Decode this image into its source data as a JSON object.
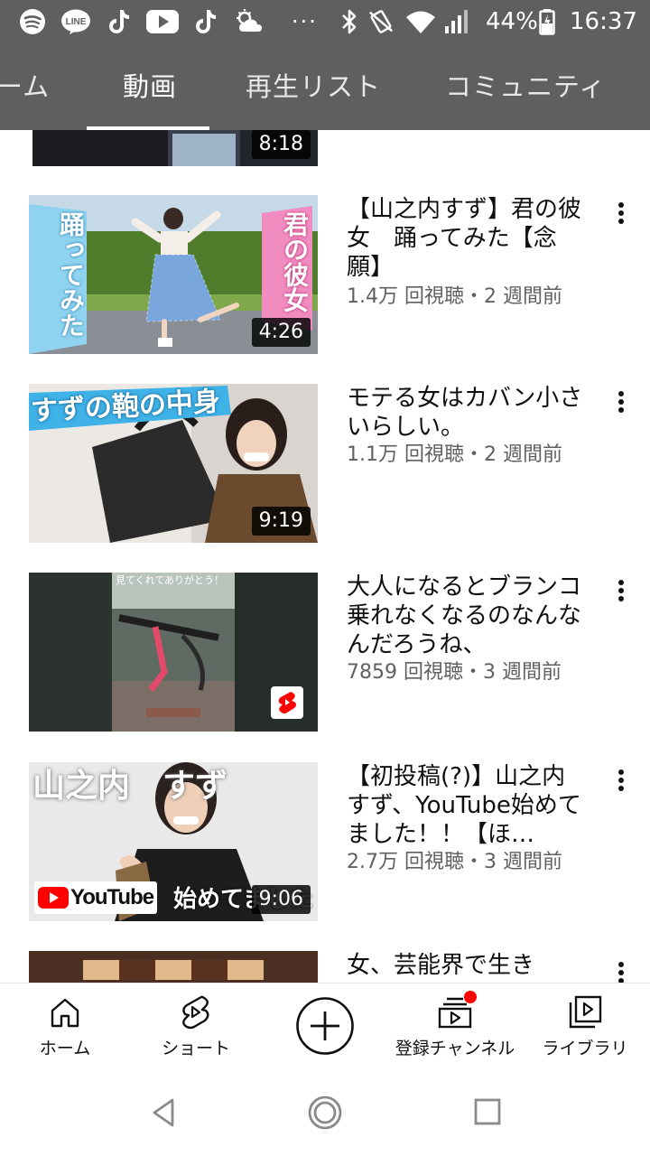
{
  "status_bar": {
    "icons": [
      "spotify-icon",
      "line-icon",
      "tiktok-icon",
      "youtube-icon",
      "tiktok-icon",
      "weather-icon",
      "more-notifications-icon",
      "bluetooth-icon",
      "vibrate-icon",
      "wifi-icon",
      "signal-icon",
      "battery-icon"
    ],
    "line_label": "LINE",
    "more_label": "···",
    "battery": "44%",
    "time": "16:37"
  },
  "tabs": [
    {
      "label": "ーム",
      "active": false
    },
    {
      "label": "動画",
      "active": true
    },
    {
      "label": "再生リスト",
      "active": false
    },
    {
      "label": "コミュニティ",
      "active": false
    }
  ],
  "videos": [
    {
      "title": "",
      "meta": "",
      "duration": "8:18"
    },
    {
      "title": "【山之内すず】君の彼女　踊ってみた【念願】",
      "meta": "1.4万 回視聴・2 週間前",
      "duration": "4:26",
      "thumb_text_left": "踊ってみた",
      "thumb_text_right": "君の彼女"
    },
    {
      "title": "モテる女はカバン小さいらしい。",
      "meta": "1.1万 回視聴・2 週間前",
      "duration": "9:19",
      "thumb_text": "すずの鞄の中身"
    },
    {
      "title": "大人になるとブランコ乗れなくなるのなんなんだろうね、",
      "meta": "7859 回視聴・3 週間前",
      "duration": "",
      "shorts_badge": true,
      "thumb_text": "見てくれてありがとう！"
    },
    {
      "title": "【初投稿(?)】山之内すず、YouTube始めてました！！【ほ…",
      "meta": "2.7万 回視聴・3 週間前",
      "duration": "9:06",
      "thumb_text_top": "山之内　すず",
      "thumb_logo": "YouTube",
      "thumb_text_bottom": "始めてました"
    },
    {
      "title": "女、芸能界で生き",
      "meta": "",
      "duration": ""
    }
  ],
  "bottom_nav": [
    {
      "label": "ホーム",
      "icon": "home-icon"
    },
    {
      "label": "ショート",
      "icon": "shorts-icon"
    },
    {
      "label": "",
      "icon": "create-plus-icon"
    },
    {
      "label": "登録チャンネル",
      "icon": "subscriptions-icon",
      "badge": true
    },
    {
      "label": "ライブラリ",
      "icon": "library-icon"
    }
  ],
  "android_nav": [
    "back-icon",
    "home-circle-icon",
    "recents-icon"
  ],
  "colors": {
    "header_bg": "#5f5f5f",
    "accent_red": "#ff0000",
    "meta_gray": "#606060"
  }
}
